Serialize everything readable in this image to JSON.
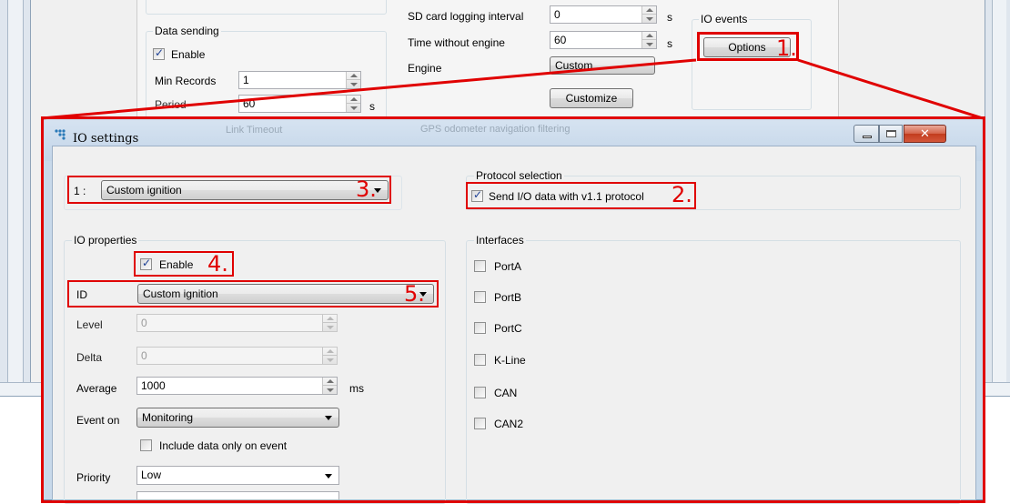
{
  "background_window": {
    "data_sending": {
      "group_title": "Data sending",
      "enable_label": "Enable",
      "enable_checked": true,
      "min_records_label": "Min Records",
      "min_records_value": "1",
      "period_label": "Period",
      "period_value": "60",
      "period_unit": "s"
    },
    "logging": {
      "sd_card_label": "SD card logging interval",
      "sd_card_value": "0",
      "sd_card_unit": "s",
      "time_without_engine_label": "Time without engine",
      "time_without_engine_value": "60",
      "time_without_engine_unit": "s",
      "engine_label": "Engine",
      "engine_value": "Custom",
      "customize_button": "Customize"
    },
    "io_events": {
      "group_title": "IO events",
      "options_button": "Options"
    }
  },
  "dialog": {
    "title": "IO settings",
    "ghost_row": {
      "left": "Link Timeout",
      "right": "GPS odometer navigation filtering"
    },
    "io_selector": {
      "prefix": "1 :",
      "value": "Custom ignition"
    },
    "protocol_selection": {
      "group_title": "Protocol selection",
      "send_label": "Send I/O data with v1.1 protocol",
      "send_checked": true
    },
    "io_properties": {
      "group_title": "IO properties",
      "enable_label": "Enable",
      "enable_checked": true,
      "id_label": "ID",
      "id_value": "Custom ignition",
      "level_label": "Level",
      "level_value": "0",
      "delta_label": "Delta",
      "delta_value": "0",
      "average_label": "Average",
      "average_value": "1000",
      "average_unit": "ms",
      "event_on_label": "Event on",
      "event_on_value": "Monitoring",
      "include_label": "Include data only on event",
      "include_checked": false,
      "priority_label": "Priority",
      "priority_value": "Low"
    },
    "interfaces": {
      "group_title": "Interfaces",
      "items": [
        {
          "label": "PortA",
          "checked": false
        },
        {
          "label": "PortB",
          "checked": false
        },
        {
          "label": "PortC",
          "checked": false
        },
        {
          "label": "K-Line",
          "checked": false
        },
        {
          "label": "CAN",
          "checked": false
        },
        {
          "label": "CAN2",
          "checked": false
        }
      ]
    }
  },
  "annotations": [
    "1.",
    "2.",
    "3.",
    "4.",
    "5."
  ],
  "colors": {
    "annotation_red": "#e00000",
    "dialog_frame": "#c8d9ea",
    "close_button": "#c23c1e"
  }
}
